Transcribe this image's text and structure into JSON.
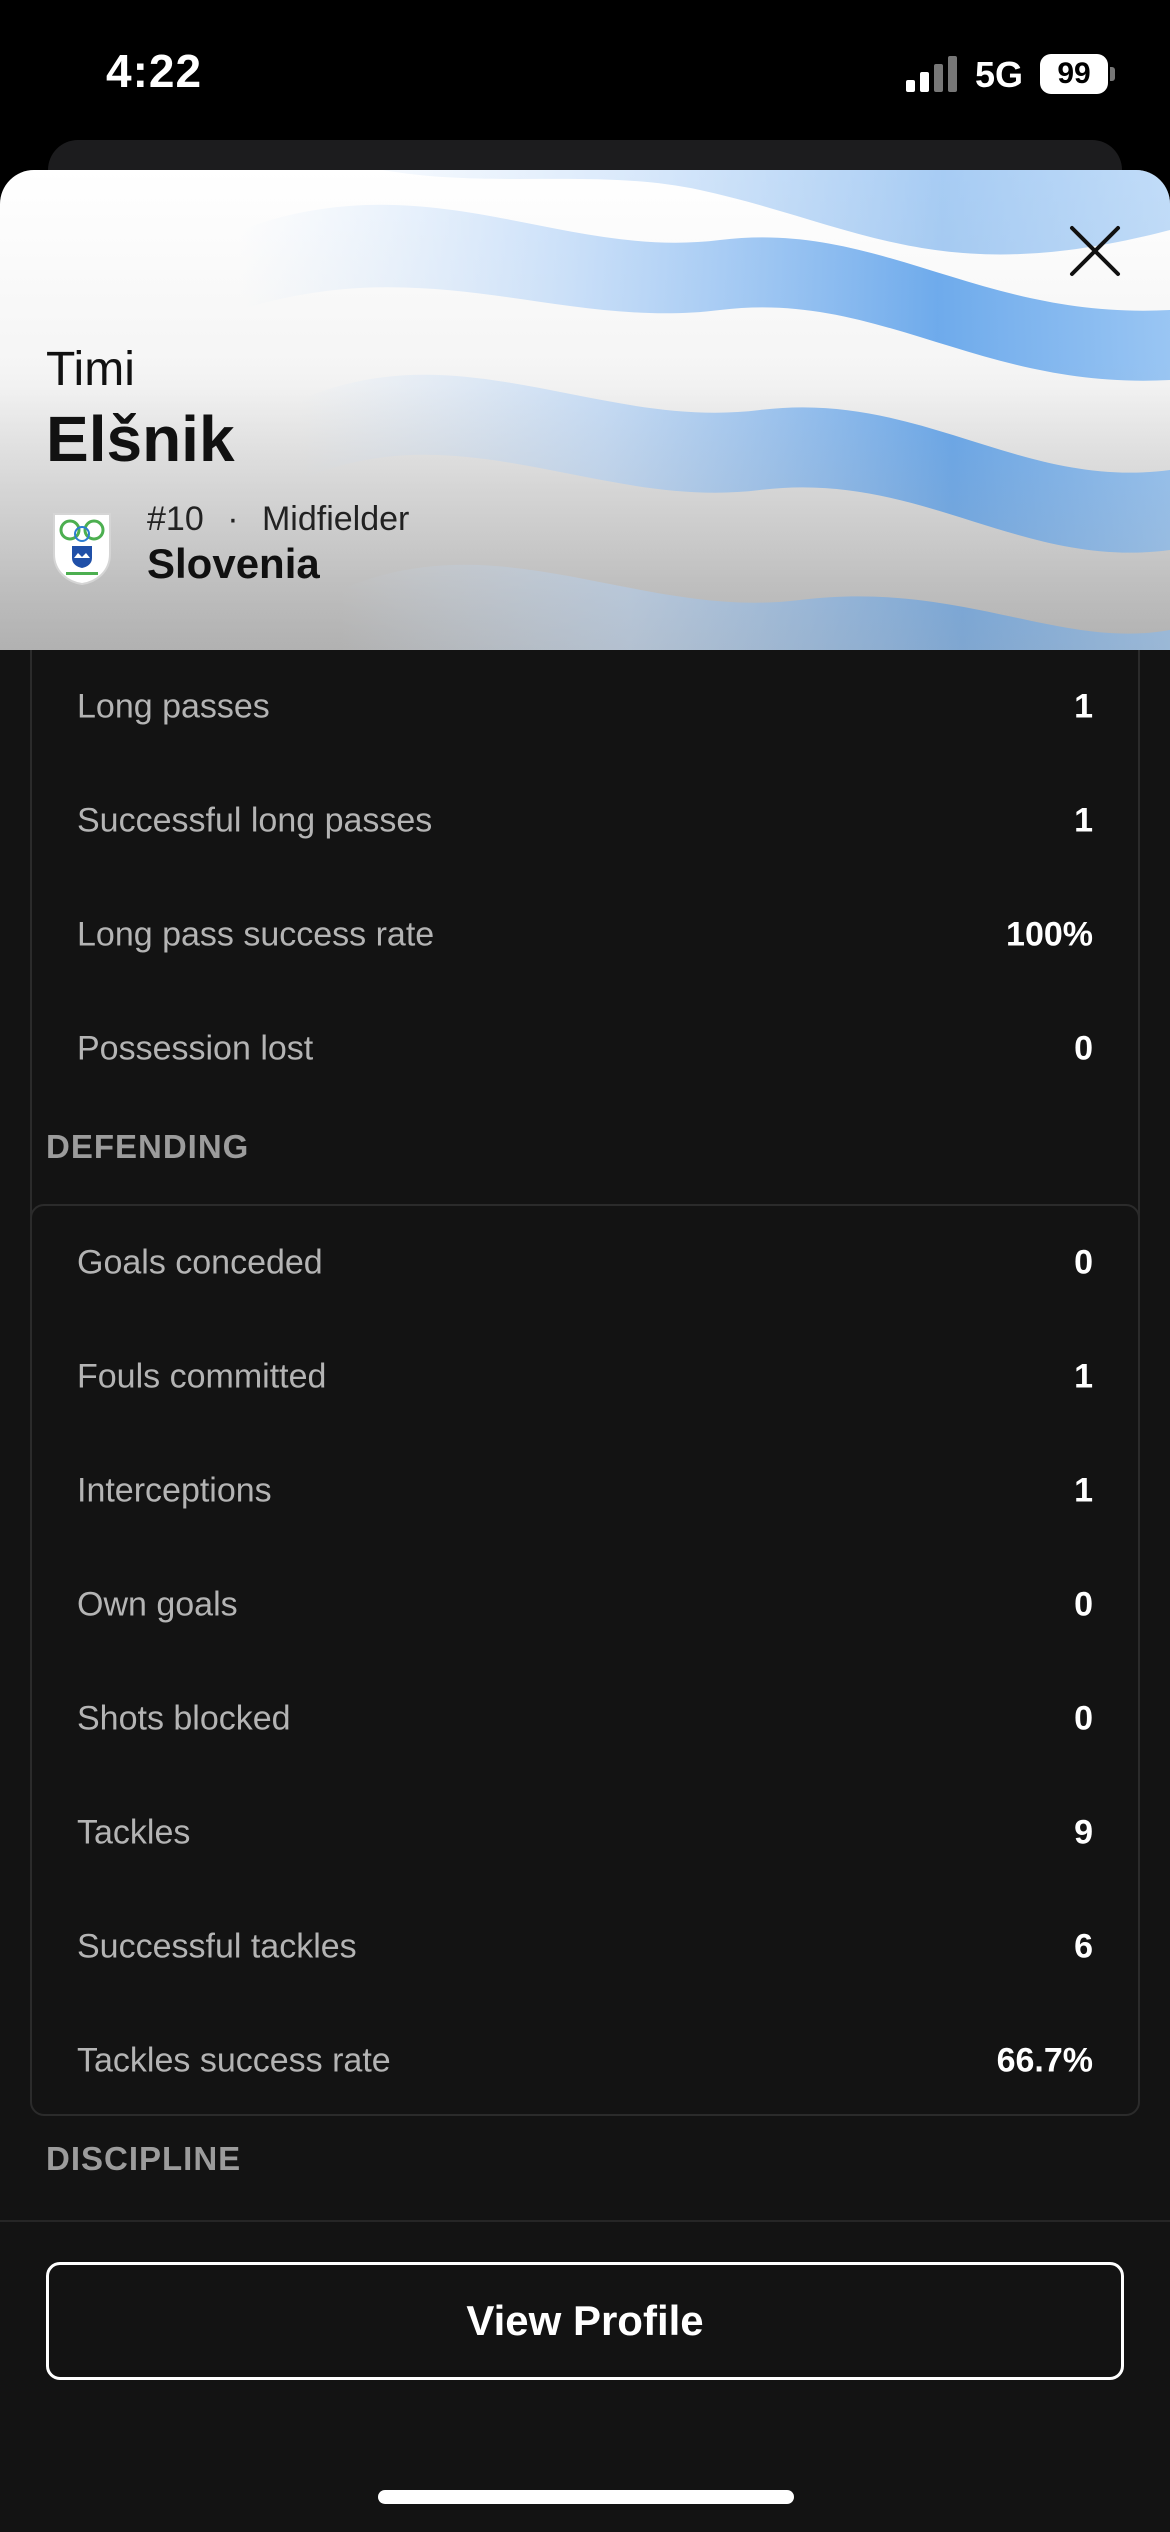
{
  "status_bar": {
    "time": "4:22",
    "network": "5G",
    "battery": "99"
  },
  "player": {
    "first_name": "Timi",
    "last_name": "Elšnik",
    "number": "#10",
    "separator": "·",
    "position": "Midfielder",
    "team": "Slovenia"
  },
  "stats_top": [
    {
      "label": "Long passes",
      "value": "1"
    },
    {
      "label": "Successful long passes",
      "value": "1"
    },
    {
      "label": "Long pass success rate",
      "value": "100%"
    },
    {
      "label": "Possession lost",
      "value": "0"
    }
  ],
  "sections": {
    "defending": "DEFENDING",
    "discipline": "DISCIPLINE"
  },
  "defending": [
    {
      "label": "Goals conceded",
      "value": "0"
    },
    {
      "label": "Fouls committed",
      "value": "1"
    },
    {
      "label": "Interceptions",
      "value": "1"
    },
    {
      "label": "Own goals",
      "value": "0"
    },
    {
      "label": "Shots blocked",
      "value": "0"
    },
    {
      "label": "Tackles",
      "value": "9"
    },
    {
      "label": "Successful tackles",
      "value": "6"
    },
    {
      "label": "Tackles success rate",
      "value": "66.7%"
    }
  ],
  "actions": {
    "view_profile": "View Profile"
  },
  "icons": {
    "close": "close-icon",
    "crest": "team-crest-icon",
    "signal": "signal-icon",
    "battery": "battery-icon"
  },
  "colors": {
    "background": "#131313",
    "accent_blue": "#4a90e2",
    "label": "#b4b4b4",
    "value": "#ffffff"
  }
}
